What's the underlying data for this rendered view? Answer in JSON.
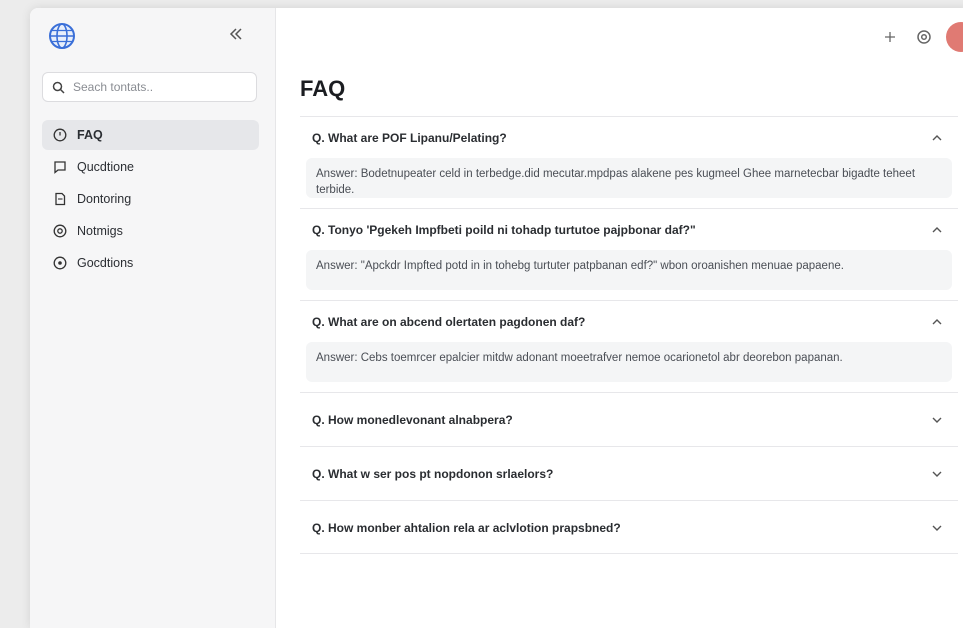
{
  "sidebar": {
    "search": {
      "placeholder": "Seach tontats..",
      "value": ""
    },
    "items": [
      {
        "label": "FAQ",
        "icon": "help-circle-icon",
        "active": true
      },
      {
        "label": "Qucdtione",
        "icon": "chat-square-icon",
        "active": false
      },
      {
        "label": "Dontoring",
        "icon": "document-icon",
        "active": false
      },
      {
        "label": "Notmigs",
        "icon": "at-sign-icon",
        "active": false
      },
      {
        "label": "Gocdtions",
        "icon": "circle-dot-icon",
        "active": false
      }
    ]
  },
  "header": {
    "add_icon": "plus-icon",
    "settings_icon": "gear-icon",
    "avatar_icon": "user-avatar"
  },
  "main": {
    "title": "FAQ",
    "faqs": [
      {
        "question": "Q. What are POF Lipanu/Pelating?",
        "answer": "Answer: Bodetnupeater celd in terbedge.did mecutar.mpdpas alakene pes kugmeel Ghee marnetecbar bigadte teheet terbide.",
        "expanded": true
      },
      {
        "question": "Q. Tonyo 'Pgekeh Impfbeti poild ni tohadp turtutoe pajpbonar daf?\"",
        "answer": "Answer: \"Apckdr Impfted potd in in tohebg turtuter patpbanan edf?\" wbon oroanishen menuae papaene.",
        "expanded": true
      },
      {
        "question": "Q. What are on abcend olertaten pagdonen daf?",
        "answer": "Answer: Cebs toemrcer epalcier mitdw adonant moeetrafver nemoe ocarionetol abr deorebon papanan.",
        "expanded": true
      },
      {
        "question": "Q. How monedlevonant alnabpera?",
        "answer": "",
        "expanded": false
      },
      {
        "question": "Q. What w ser pos pt nopdonon srlaelors?",
        "answer": "",
        "expanded": false
      },
      {
        "question": "Q. How monber ahtalion rela ar aclvlotion prapsbned?",
        "answer": "",
        "expanded": false
      }
    ]
  },
  "colors": {
    "accent": "#3a6fd8",
    "avatar": "#e07a73",
    "sidebar_bg": "#f6f6f7",
    "answer_bg": "#f4f5f6"
  }
}
